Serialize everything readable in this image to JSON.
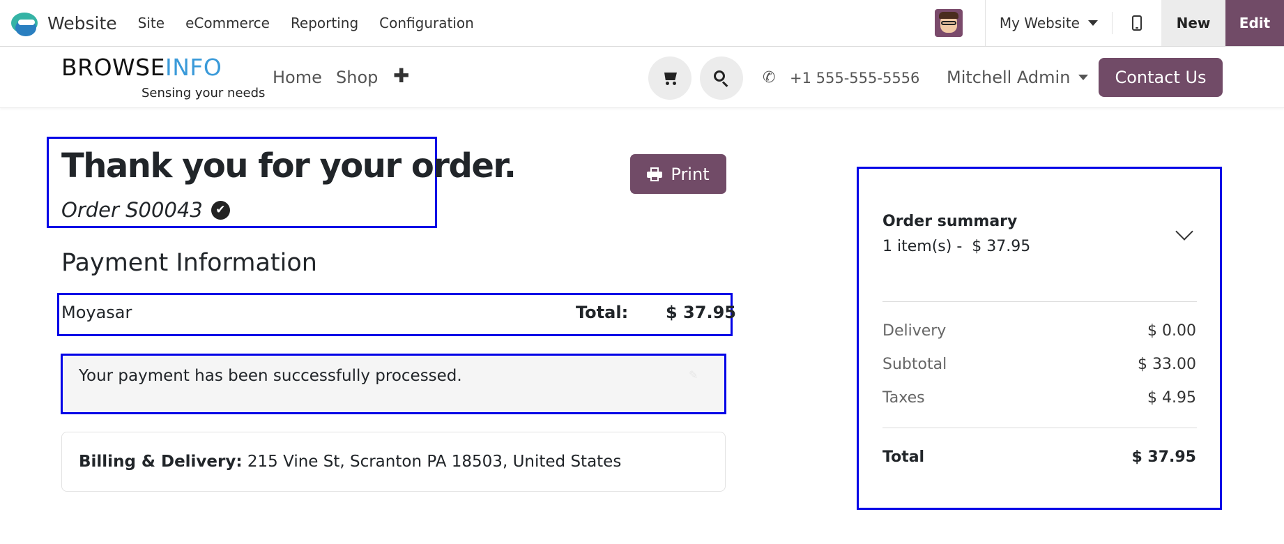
{
  "adminbar": {
    "app_title": "Website",
    "menu": [
      "Site",
      "eCommerce",
      "Reporting",
      "Configuration"
    ],
    "website_selector": "My Website",
    "new_label": "New",
    "edit_label": "Edit",
    "icons": {
      "app_logo": "odoo-website-logo-icon",
      "avatar": "user-avatar",
      "mobile": "mobile-phone-icon"
    }
  },
  "site": {
    "brand_word_a": "BROWSE",
    "brand_word_b": "INFO",
    "brand_tagline": "Sensing your needs",
    "nav": [
      "Home",
      "Shop"
    ],
    "add_icon": "✚",
    "phone": "+1 555-555-5556",
    "user": "Mitchell Admin",
    "contact_label": "Contact Us",
    "colors": {
      "accent": "#714b67",
      "brand_info": "#3a9ad9"
    }
  },
  "order": {
    "title": "Thank you for your order.",
    "reference": "Order S00043",
    "check_glyph": "✔",
    "print_label": "Print",
    "payment_heading": "Payment Information",
    "payment_method": "Moyasar",
    "total_label": "Total:",
    "total_value": "$ 37.95",
    "message": "Your payment has been successfully processed.",
    "address_label": "Billing & Delivery:",
    "address_value": " 215 Vine St, Scranton PA 18503, United States"
  },
  "summary": {
    "title": "Order summary",
    "subtitle": "1 item(s) -  $ 37.95",
    "rows": [
      {
        "label": "Delivery",
        "value": "$ 0.00"
      },
      {
        "label": "Subtotal",
        "value": "$ 33.00"
      },
      {
        "label": "Taxes",
        "value": "$ 4.95"
      }
    ],
    "total_label": "Total",
    "total_value": "$ 37.95"
  }
}
